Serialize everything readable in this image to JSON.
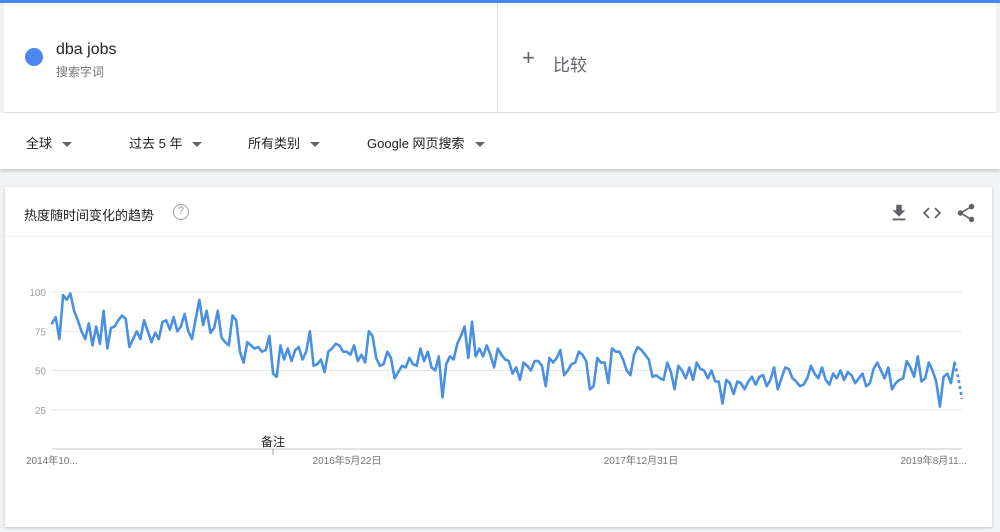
{
  "search_term": {
    "name": "dba jobs",
    "subtitle": "搜索字词",
    "color": "#4e86ef"
  },
  "compare": {
    "icon": "plus-icon",
    "label": "比较"
  },
  "filters": [
    {
      "label": "全球"
    },
    {
      "label": "过去 5 年"
    },
    {
      "label": "所有类别"
    },
    {
      "label": "Google 网页搜索"
    }
  ],
  "card": {
    "title": "热度随时间变化的趋势",
    "help_icon": "question-circle-icon",
    "icons": [
      "download-icon",
      "embed-icon",
      "share-icon"
    ]
  },
  "chart_data": {
    "type": "line",
    "y_ticks": [
      "100",
      "75",
      "50",
      "25"
    ],
    "ylim": [
      0,
      100
    ],
    "x_labels": [
      "2014年10...",
      "2016年5月22日",
      "2017年12月31日",
      "2019年8月11..."
    ],
    "annotation": "备注",
    "grid": true,
    "line_color": "#4a90e2",
    "series": [
      {
        "values": [
          80,
          84,
          70,
          98,
          95,
          99,
          88,
          82,
          75,
          70,
          80,
          66,
          78,
          67,
          88,
          64,
          77,
          78,
          82,
          85,
          83,
          65,
          70,
          75,
          70,
          82,
          75,
          68,
          74,
          70,
          81,
          82,
          76,
          84,
          75,
          78,
          86,
          75,
          70,
          83,
          95,
          79,
          88,
          74,
          77,
          88,
          71,
          68,
          66,
          85,
          82,
          62,
          55,
          68,
          66,
          64,
          65,
          62,
          63,
          72,
          48,
          46,
          66,
          57,
          64,
          56,
          63,
          65,
          57,
          62,
          75,
          53,
          54,
          57,
          49,
          62,
          64,
          67,
          66,
          62,
          62,
          60,
          66,
          56,
          60,
          55,
          75,
          72,
          58,
          53,
          54,
          62,
          58,
          45,
          49,
          53,
          52,
          58,
          54,
          53,
          64,
          56,
          62,
          52,
          50,
          59,
          33,
          54,
          59,
          57,
          67,
          72,
          78,
          58,
          81,
          59,
          64,
          59,
          66,
          60,
          52,
          64,
          60,
          57,
          56,
          48,
          52,
          44,
          55,
          53,
          50,
          56,
          56,
          53,
          40,
          58,
          55,
          58,
          63,
          47,
          50,
          54,
          55,
          62,
          60,
          56,
          38,
          40,
          58,
          55,
          55,
          42,
          64,
          62,
          62,
          57,
          50,
          47,
          60,
          65,
          63,
          60,
          57,
          46,
          47,
          45,
          44,
          55,
          49,
          38,
          53,
          50,
          45,
          52,
          44,
          55,
          51,
          50,
          45,
          50,
          43,
          43,
          29,
          44,
          42,
          35,
          43,
          42,
          38,
          43,
          46,
          41,
          46,
          47,
          40,
          44,
          52,
          38,
          45,
          52,
          51,
          45,
          43,
          40,
          41,
          45,
          53,
          48,
          45,
          52,
          44,
          41,
          48,
          45,
          50,
          44,
          49,
          47,
          42,
          45,
          48,
          40,
          42,
          51,
          55,
          50,
          45,
          52,
          38,
          42,
          44,
          45,
          56,
          52,
          46,
          59,
          43,
          45,
          55,
          50,
          43,
          27,
          46,
          48,
          42,
          55
        ]
      }
    ],
    "partial_values": [
      55,
      45,
      32
    ]
  }
}
